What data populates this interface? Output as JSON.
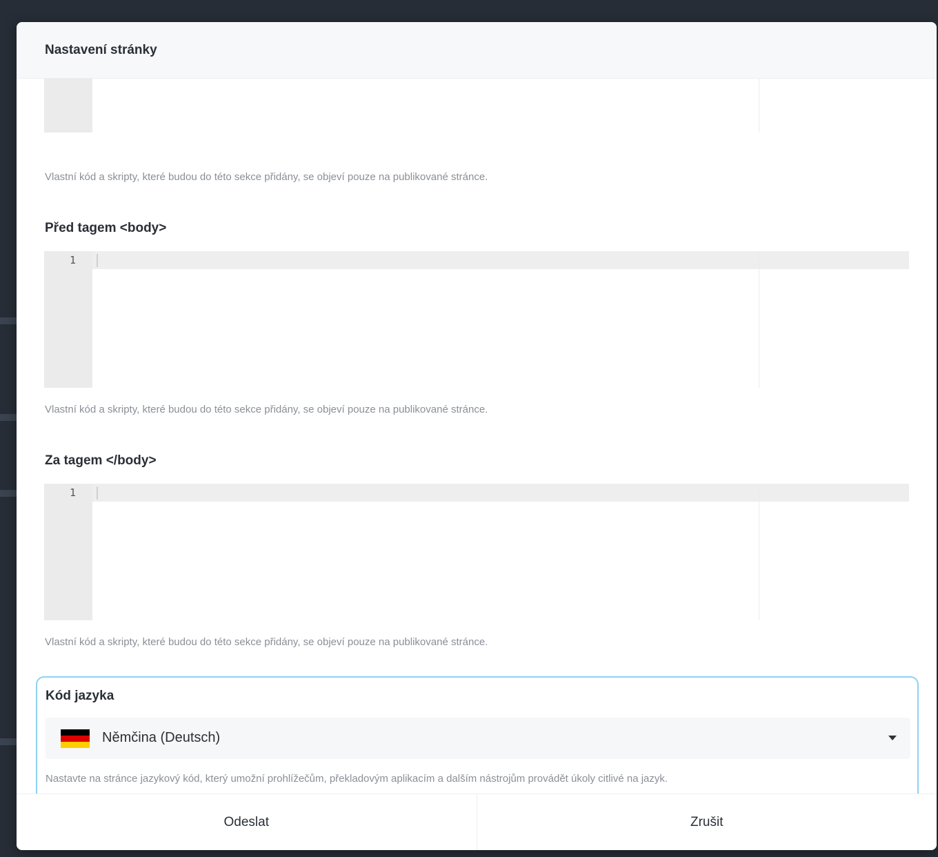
{
  "modal": {
    "title": "Nastavení stránky"
  },
  "code_sections": [
    {
      "label": "",
      "line_number": "",
      "help": "Vlastní kód a skripty, které budou do této sekce přidány, se objeví pouze na publikované stránce."
    },
    {
      "label": "Před tagem <body>",
      "line_number": "1",
      "help": "Vlastní kód a skripty, které budou do této sekce přidány, se objeví pouze na publikované stránce."
    },
    {
      "label": "Za tagem </body>",
      "line_number": "1",
      "help": "Vlastní kód a skripty, které budou do této sekce přidány, se objeví pouze na publikované stránce."
    }
  ],
  "language": {
    "label": "Kód jazyka",
    "selected": "Němčina (Deutsch)",
    "flag_icon": "flag-germany-icon",
    "flag_colors": [
      "#000000",
      "#dd0000",
      "#ffce00"
    ],
    "help": "Nastavte na stránce jazykový kód, který umožní prohlížečům, překladovým aplikacím a dalším nástrojům provádět úkoly citlivé na jazyk."
  },
  "footer": {
    "submit_label": "Odeslat",
    "cancel_label": "Zrušit"
  },
  "colors": {
    "focus_border": "#8fd1f3",
    "gutter": "#ebebeb"
  }
}
